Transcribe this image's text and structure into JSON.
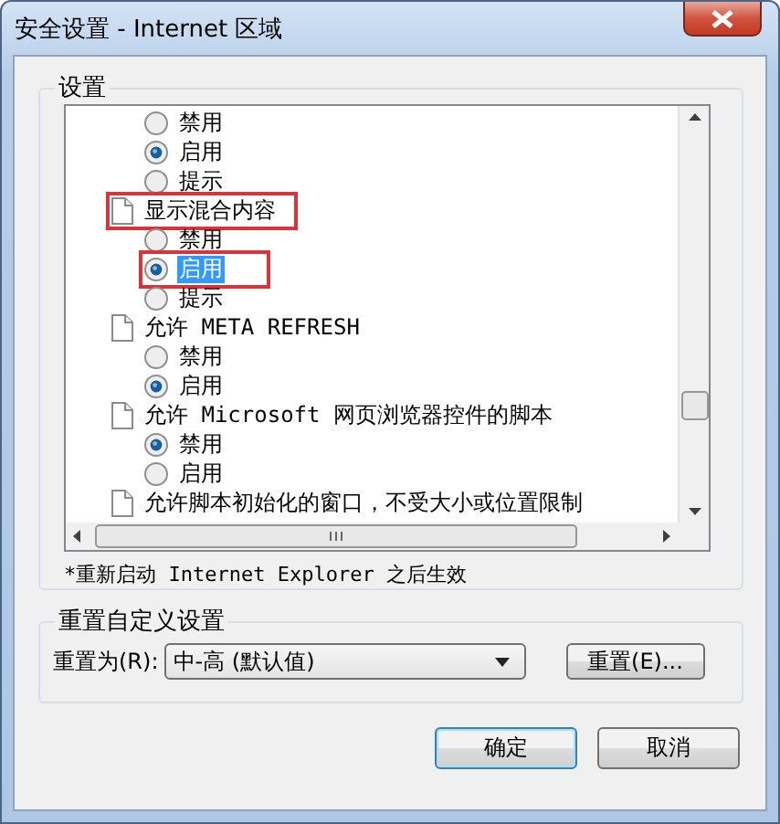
{
  "window": {
    "title": "安全设置 - Internet 区域"
  },
  "settings": {
    "label": "设置",
    "items": [
      {
        "kind": "radio",
        "label": "禁用",
        "checked": false,
        "selected": false,
        "highlighted": false
      },
      {
        "kind": "radio",
        "label": "启用",
        "checked": true,
        "selected": false,
        "highlighted": false
      },
      {
        "kind": "radio",
        "label": "提示",
        "checked": false,
        "selected": false,
        "highlighted": false
      },
      {
        "kind": "heading",
        "label": "显示混合内容",
        "highlighted": true,
        "children": [
          {
            "kind": "radio",
            "label": "禁用",
            "checked": false,
            "selected": false,
            "highlighted": false
          },
          {
            "kind": "radio",
            "label": "启用",
            "checked": true,
            "selected": true,
            "highlighted": true
          },
          {
            "kind": "radio",
            "label": "提示",
            "checked": false,
            "selected": false,
            "highlighted": false
          }
        ]
      },
      {
        "kind": "heading",
        "label": "允许 META REFRESH",
        "highlighted": false,
        "children": [
          {
            "kind": "radio",
            "label": "禁用",
            "checked": false,
            "selected": false,
            "highlighted": false
          },
          {
            "kind": "radio",
            "label": "启用",
            "checked": true,
            "selected": false,
            "highlighted": false
          }
        ]
      },
      {
        "kind": "heading",
        "label": "允许 Microsoft 网页浏览器控件的脚本",
        "highlighted": false,
        "children": [
          {
            "kind": "radio",
            "label": "禁用",
            "checked": true,
            "selected": false,
            "highlighted": false
          },
          {
            "kind": "radio",
            "label": "启用",
            "checked": false,
            "selected": false,
            "highlighted": false
          }
        ]
      },
      {
        "kind": "heading",
        "label": "允许脚本初始化的窗口，不受大小或位置限制",
        "highlighted": false
      }
    ],
    "note": "*重新启动 Internet Explorer 之后生效"
  },
  "reset": {
    "label": "重置自定义设置",
    "reset_to_label": "重置为(R):",
    "dropdown_value": "中-高 (默认值)",
    "reset_button": "重置(E)..."
  },
  "buttons": [
    {
      "label": "确定",
      "default": true
    },
    {
      "label": "取消",
      "default": false
    }
  ]
}
